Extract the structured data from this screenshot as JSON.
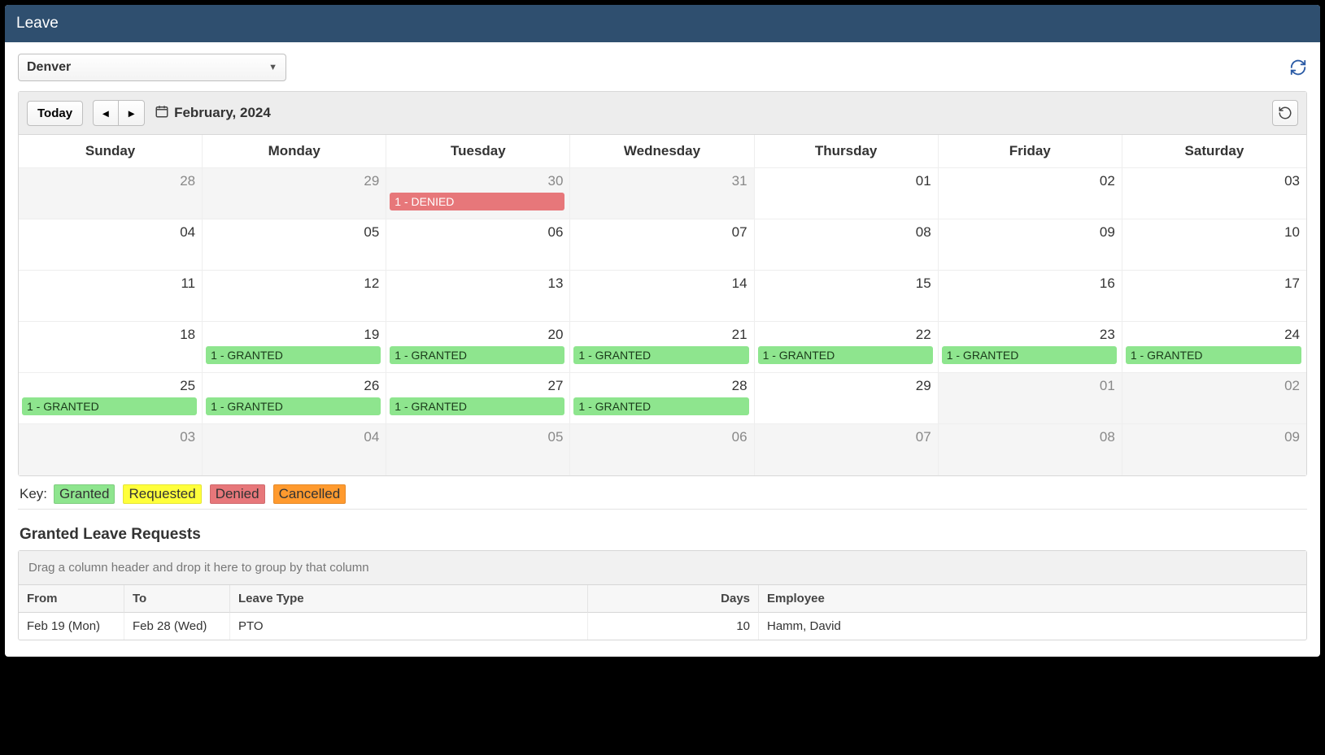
{
  "header": {
    "title": "Leave"
  },
  "location": {
    "selected": "Denver"
  },
  "calendar": {
    "today_label": "Today",
    "month_label": "February, 2024",
    "day_headers": [
      "Sunday",
      "Monday",
      "Tuesday",
      "Wednesday",
      "Thursday",
      "Friday",
      "Saturday"
    ],
    "weeks": [
      [
        {
          "d": "28",
          "other": true,
          "event": null
        },
        {
          "d": "29",
          "other": true,
          "event": null
        },
        {
          "d": "30",
          "other": true,
          "event": {
            "text": "1 - DENIED",
            "type": "denied"
          }
        },
        {
          "d": "31",
          "other": true,
          "event": null
        },
        {
          "d": "01",
          "other": false,
          "event": null
        },
        {
          "d": "02",
          "other": false,
          "event": null
        },
        {
          "d": "03",
          "other": false,
          "event": null
        }
      ],
      [
        {
          "d": "04",
          "other": false,
          "event": null
        },
        {
          "d": "05",
          "other": false,
          "event": null
        },
        {
          "d": "06",
          "other": false,
          "event": null
        },
        {
          "d": "07",
          "other": false,
          "event": null
        },
        {
          "d": "08",
          "other": false,
          "event": null
        },
        {
          "d": "09",
          "other": false,
          "event": null
        },
        {
          "d": "10",
          "other": false,
          "event": null
        }
      ],
      [
        {
          "d": "11",
          "other": false,
          "event": null
        },
        {
          "d": "12",
          "other": false,
          "event": null
        },
        {
          "d": "13",
          "other": false,
          "event": null
        },
        {
          "d": "14",
          "other": false,
          "event": null
        },
        {
          "d": "15",
          "other": false,
          "event": null
        },
        {
          "d": "16",
          "other": false,
          "event": null
        },
        {
          "d": "17",
          "other": false,
          "event": null
        }
      ],
      [
        {
          "d": "18",
          "other": false,
          "event": null
        },
        {
          "d": "19",
          "other": false,
          "event": {
            "text": "1 - GRANTED",
            "type": "granted"
          }
        },
        {
          "d": "20",
          "other": false,
          "event": {
            "text": "1 - GRANTED",
            "type": "granted"
          }
        },
        {
          "d": "21",
          "other": false,
          "event": {
            "text": "1 - GRANTED",
            "type": "granted"
          }
        },
        {
          "d": "22",
          "other": false,
          "event": {
            "text": "1 - GRANTED",
            "type": "granted"
          }
        },
        {
          "d": "23",
          "other": false,
          "event": {
            "text": "1 - GRANTED",
            "type": "granted"
          }
        },
        {
          "d": "24",
          "other": false,
          "event": {
            "text": "1 - GRANTED",
            "type": "granted"
          }
        }
      ],
      [
        {
          "d": "25",
          "other": false,
          "event": {
            "text": "1 - GRANTED",
            "type": "granted"
          }
        },
        {
          "d": "26",
          "other": false,
          "event": {
            "text": "1 - GRANTED",
            "type": "granted"
          }
        },
        {
          "d": "27",
          "other": false,
          "event": {
            "text": "1 - GRANTED",
            "type": "granted"
          }
        },
        {
          "d": "28",
          "other": false,
          "event": {
            "text": "1 - GRANTED",
            "type": "granted"
          }
        },
        {
          "d": "29",
          "other": false,
          "event": null
        },
        {
          "d": "01",
          "other": true,
          "event": null
        },
        {
          "d": "02",
          "other": true,
          "event": null
        }
      ],
      [
        {
          "d": "03",
          "other": true,
          "event": null
        },
        {
          "d": "04",
          "other": true,
          "event": null
        },
        {
          "d": "05",
          "other": true,
          "event": null
        },
        {
          "d": "06",
          "other": true,
          "event": null
        },
        {
          "d": "07",
          "other": true,
          "event": null
        },
        {
          "d": "08",
          "other": true,
          "event": null
        },
        {
          "d": "09",
          "other": true,
          "event": null
        }
      ]
    ]
  },
  "key": {
    "label": "Key:",
    "granted": "Granted",
    "requested": "Requested",
    "denied": "Denied",
    "cancelled": "Cancelled"
  },
  "granted_section": {
    "title": "Granted Leave Requests",
    "group_hint": "Drag a column header and drop it here to group by that column",
    "cols": {
      "from": "From",
      "to": "To",
      "leave_type": "Leave Type",
      "days": "Days",
      "employee": "Employee"
    },
    "rows": [
      {
        "from": "Feb 19 (Mon)",
        "to": "Feb 28 (Wed)",
        "leave_type": "PTO",
        "days": "10",
        "employee": "Hamm, David"
      }
    ]
  }
}
